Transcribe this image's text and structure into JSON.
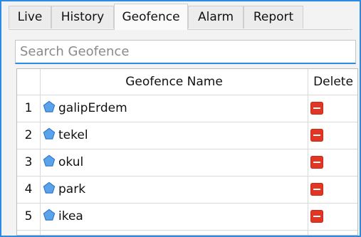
{
  "tabs": [
    {
      "label": "Live",
      "active": false
    },
    {
      "label": "History",
      "active": false
    },
    {
      "label": "Geofence",
      "active": true
    },
    {
      "label": "Alarm",
      "active": false
    },
    {
      "label": "Report",
      "active": false
    }
  ],
  "search": {
    "placeholder": "Search Geofence",
    "value": ""
  },
  "table": {
    "columns": {
      "index": "",
      "name": "Geofence Name",
      "delete": "Delete"
    },
    "rows": [
      {
        "index": "1",
        "name": "galipErdem",
        "icon": "pentagon-icon"
      },
      {
        "index": "2",
        "name": "tekel",
        "icon": "pentagon-icon"
      },
      {
        "index": "3",
        "name": "okul",
        "icon": "pentagon-icon"
      },
      {
        "index": "4",
        "name": "park",
        "icon": "pentagon-icon"
      },
      {
        "index": "5",
        "name": "ikea",
        "icon": "pentagon-icon"
      }
    ],
    "delete_icon": "remove-icon"
  },
  "colors": {
    "accent": "#2b8ae6",
    "delete": "#e33524",
    "geofence_icon": "#5aa3ea"
  }
}
